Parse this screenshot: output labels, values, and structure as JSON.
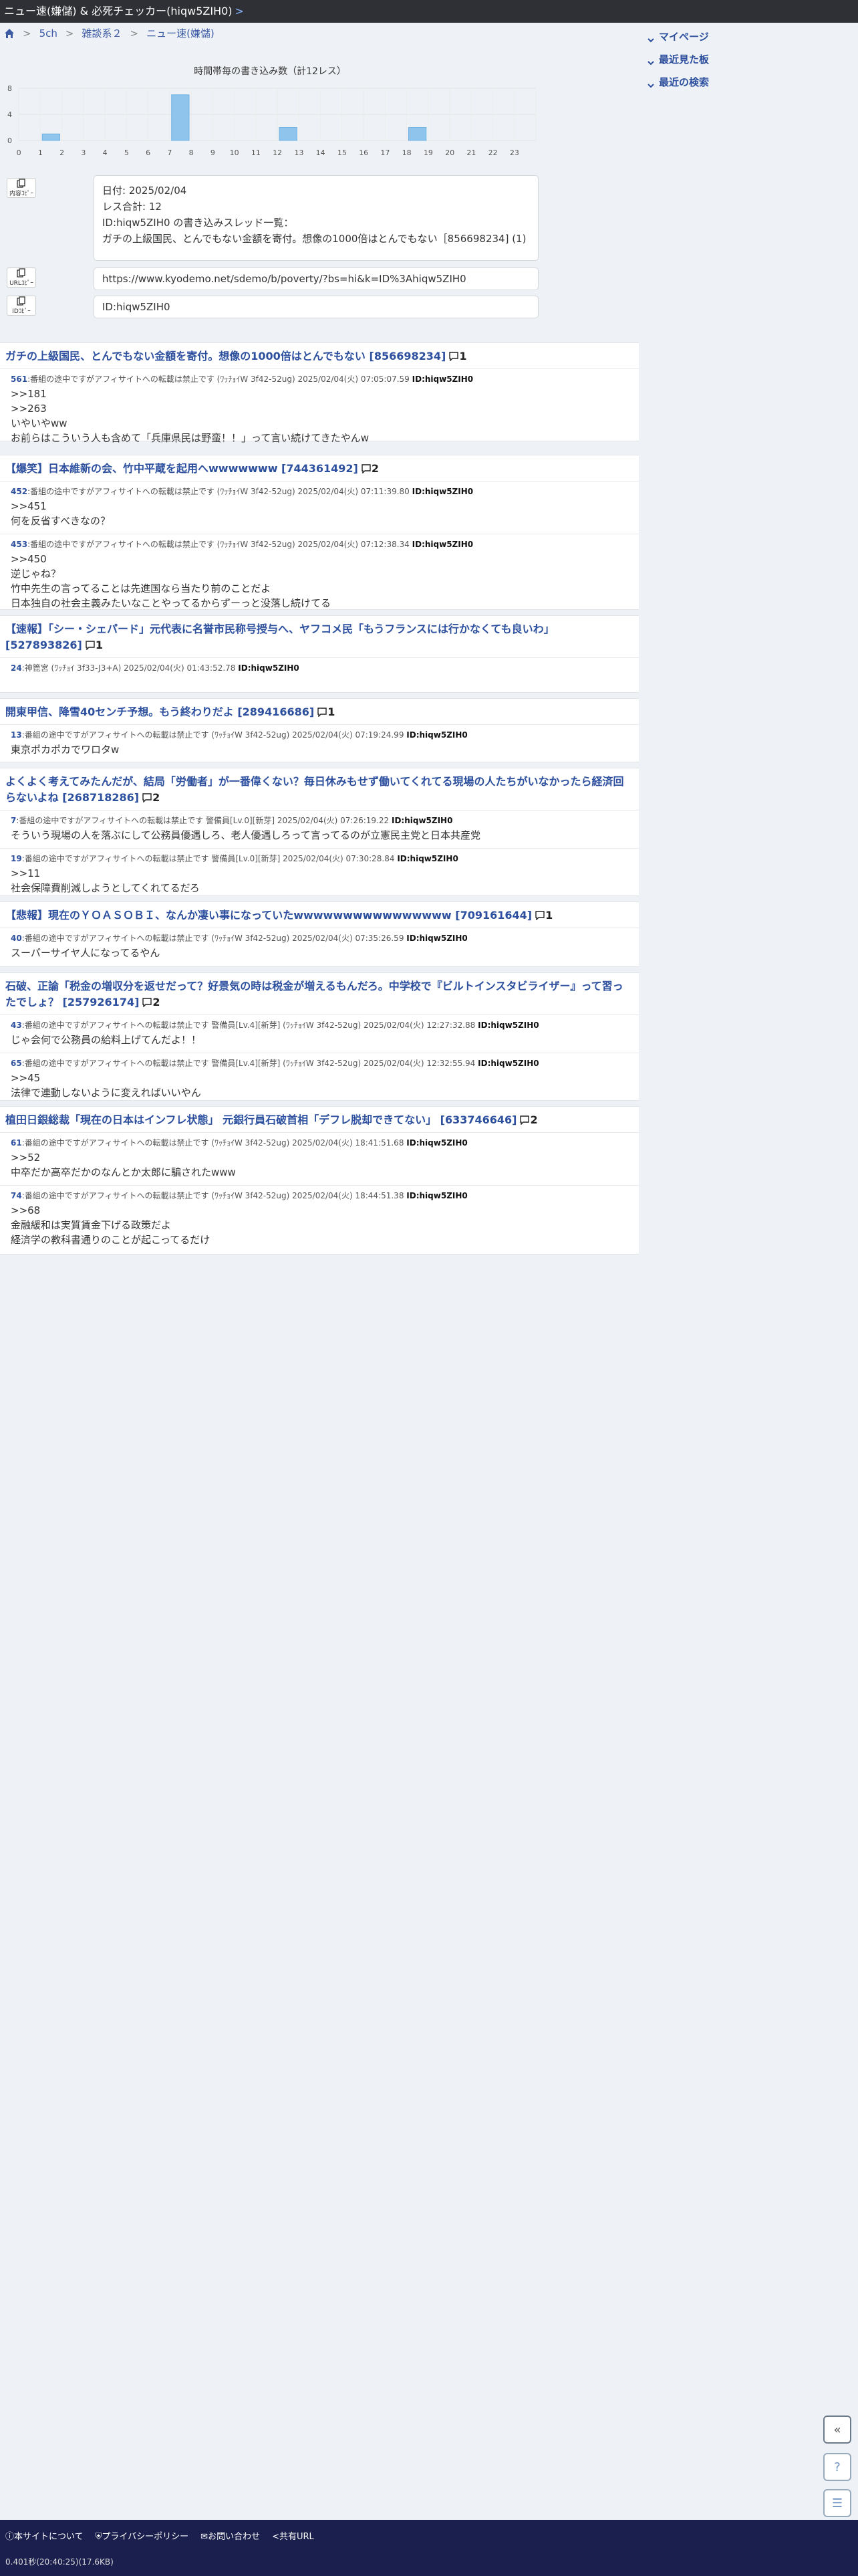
{
  "topbar": {
    "title": "ニュー速(嫌儲) & 必死チェッカー(hiqw5ZIH0)",
    "chevron": ">"
  },
  "breadcrumb": {
    "items": [
      "5ch",
      "雑談系２",
      "ニュー速(嫌儲)"
    ]
  },
  "rightnav": {
    "items": [
      "マイページ",
      "最近見た板",
      "最近の検索"
    ]
  },
  "chart_data": {
    "type": "bar",
    "title": "時間帯毎の書き込み数（計12レス）",
    "categories": [
      "0",
      "1",
      "2",
      "3",
      "4",
      "5",
      "6",
      "7",
      "8",
      "9",
      "10",
      "11",
      "12",
      "13",
      "14",
      "15",
      "16",
      "17",
      "18",
      "19",
      "20",
      "21",
      "22",
      "23"
    ],
    "values": [
      0,
      1,
      0,
      0,
      0,
      0,
      0,
      7,
      0,
      0,
      0,
      0,
      2,
      0,
      0,
      0,
      0,
      0,
      2,
      0,
      0,
      0,
      0,
      0
    ],
    "yticks": [
      "8",
      "4",
      "0"
    ],
    "ylim": [
      0,
      8
    ],
    "color": "#8fc4ec"
  },
  "tools": {
    "content_copy_label": "内容ｺﾋﾟｰ",
    "url_copy_label": "URLｺﾋﾟｰ",
    "id_copy_label": "IDｺﾋﾟｰ",
    "summary_lines": [
      "日付: 2025/02/04",
      "レス合計: 12",
      "ID:hiqw5ZIH0 の書き込みスレッド一覧：",
      "ガチの上級国民、とんでもない金額を寄付。想像の1000倍はとんでもない［856698234] (1)"
    ],
    "url": "https://www.kyodemo.net/sdemo/b/poverty/?bs=hi&k=ID%3Ahiqw5ZIH0",
    "id_text": "ID:hiqw5ZIH0"
  },
  "threads": [
    {
      "title": "ガチの上級国民、とんでもない金額を寄付。想像の1000倍はとんでもない [856698234]",
      "count": "1",
      "posts": [
        {
          "num": "561",
          "meta": ":番組の途中ですがアフィサイトへの転載は禁止です (ﾜｯﾁｮｲW 3f42-52ug) 2025/02/04(火) 07:05:07.59",
          "id": "ID:hiqw5ZIH0",
          "lines": [
            ">>181",
            ">>263",
            "いやいやww",
            "お前らはこういう人も含めて「兵庫県民は野蛮！！」って言い続けてきたやんw"
          ]
        }
      ]
    },
    {
      "title": "【爆笑】日本維新の会、竹中平蔵を起用へwwwwwww [744361492]",
      "count": "2",
      "posts": [
        {
          "num": "452",
          "meta": ":番組の途中ですがアフィサイトへの転載は禁止です (ﾜｯﾁｮｲW 3f42-52ug) 2025/02/04(火) 07:11:39.80",
          "id": "ID:hiqw5ZIH0",
          "lines": [
            ">>451",
            "何を反省すべきなの？"
          ]
        },
        {
          "num": "453",
          "meta": ":番組の途中ですがアフィサイトへの転載は禁止です (ﾜｯﾁｮｲW 3f42-52ug) 2025/02/04(火) 07:12:38.34",
          "id": "ID:hiqw5ZIH0",
          "lines": [
            ">>450",
            "逆じゃね？",
            "竹中先生の言ってることは先進国なら当たり前のことだよ",
            "日本独自の社会主義みたいなことやってるからずーっと没落し続けてる"
          ]
        }
      ]
    },
    {
      "title": "【速報】「シー・シェパード」元代表に名誉市民称号授与へ、ヤフコメ民「もうフランスには行かなくても良いわ」 [527893826]",
      "count": "1",
      "posts": [
        {
          "num": "24",
          "meta": ":神箆宮 (ﾜｯﾁｮｲ 3f33-J3+A) 2025/02/04(火) 01:43:52.78",
          "id": "ID:hiqw5ZIH0",
          "lines": []
        }
      ]
    },
    {
      "title": "開東甲信、降雪40センチ予想。もう終わりだよ [289416686]",
      "count": "1",
      "posts": [
        {
          "num": "13",
          "meta": ":番組の途中ですがアフィサイトへの転載は禁止です (ﾜｯﾁｮｲW 3f42-52ug) 2025/02/04(火) 07:19:24.99",
          "id": "ID:hiqw5ZIH0",
          "lines": [
            "東京ポカポカでワロタw"
          ]
        }
      ]
    },
    {
      "title": "よくよく考えてみたんだが、結局「労働者」が一番偉くない？毎日休みもせず働いてくれてる現場の人たちがいなかったら経済回らないよね [268718286]",
      "count": "2",
      "posts": [
        {
          "num": "7",
          "meta": ":番組の途中ですがアフィサイトへの転載は禁止です 警備員[Lv.0][新芽] 2025/02/04(火) 07:26:19.22",
          "id": "ID:hiqw5ZIH0",
          "lines": [
            "そういう現場の人を落ぶにして公務員優遇しろ、老人優遇しろって言ってるのが立憲民主党と日本共産党"
          ]
        },
        {
          "num": "19",
          "meta": ":番組の途中ですがアフィサイトへの転載は禁止です 警備員[Lv.0][新芽] 2025/02/04(火) 07:30:28.84",
          "id": "ID:hiqw5ZIH0",
          "lines": [
            ">>11",
            "社会保障費削減しようとしてくれてるだろ"
          ]
        }
      ]
    },
    {
      "title": "【悲報】現在のＹＯＡＳＯＢＩ、なんか凄い事になっていたwwwwwwwwwwwwwwww [709161644]",
      "count": "1",
      "posts": [
        {
          "num": "40",
          "meta": ":番組の途中ですがアフィサイトへの転載は禁止です (ﾜｯﾁｮｲW 3f42-52ug) 2025/02/04(火) 07:35:26.59",
          "id": "ID:hiqw5ZIH0",
          "lines": [
            "スーパーサイヤ人になってるやん"
          ]
        }
      ]
    },
    {
      "title": "石破、正論「税金の増収分を返せだって？好景気の時は税金が増えるもんだろ。中学校で『ビルトインスタビライザー』って習ったでしょ？ [257926174]",
      "count": "2",
      "posts": [
        {
          "num": "43",
          "meta": ":番組の途中ですがアフィサイトへの転載は禁止です 警備員[Lv.4][新芽] (ﾜｯﾁｮｲW 3f42-52ug) 2025/02/04(火) 12:27:32.88",
          "id": "ID:hiqw5ZIH0",
          "lines": [
            "じゃ会何で公務員の給料上げてんだよ！！"
          ]
        },
        {
          "num": "65",
          "meta": ":番組の途中ですがアフィサイトへの転載は禁止です 警備員[Lv.4][新芽] (ﾜｯﾁｮｲW 3f42-52ug) 2025/02/04(火) 12:32:55.94",
          "id": "ID:hiqw5ZIH0",
          "lines": [
            ">>45",
            "法律で連動しないように変えればいいやん"
          ]
        }
      ]
    },
    {
      "title": "植田日銀総裁「現在の日本はインフレ状態」 元銀行員石破首相「デフレ脱却できてない」 [633746646]",
      "count": "2",
      "posts": [
        {
          "num": "61",
          "meta": ":番組の途中ですがアフィサイトへの転載は禁止です (ﾜｯﾁｮｲW 3f42-52ug) 2025/02/04(火) 18:41:51.68",
          "id": "ID:hiqw5ZIH0",
          "lines": [
            ">>52",
            "中卒だか高卒だかのなんとか太郎に騙されたwww"
          ]
        },
        {
          "num": "74",
          "meta": ":番組の途中ですがアフィサイトへの転載は禁止です (ﾜｯﾁｮｲW 3f42-52ug) 2025/02/04(火) 18:44:51.38",
          "id": "ID:hiqw5ZIH0",
          "lines": [
            ">>68",
            "金融緩和は実質賃金下げる政策だよ",
            "経済学の教科書通りのことが起こってるだけ"
          ]
        }
      ]
    }
  ],
  "footer": {
    "links": [
      "本サイトについて",
      "プライバシーポリシー",
      "お問い合わせ",
      "共有URL"
    ],
    "stats": "0.401秒(20:40:25)(17.6KB)"
  },
  "float_buttons": [
    "«",
    "?",
    "☰"
  ]
}
